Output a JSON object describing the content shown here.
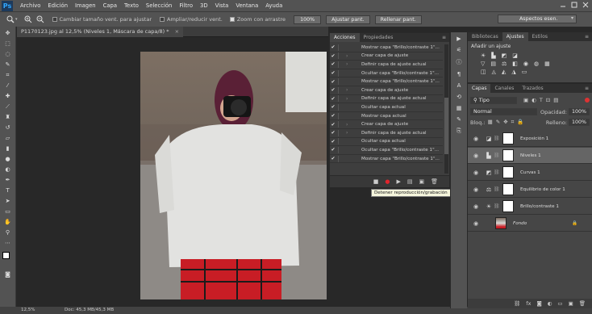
{
  "app": {
    "logo": "Ps"
  },
  "menu": [
    "Archivo",
    "Edición",
    "Imagen",
    "Capa",
    "Texto",
    "Selección",
    "Filtro",
    "3D",
    "Vista",
    "Ventana",
    "Ayuda"
  ],
  "options": {
    "resize_label": "Cambiar tamaño vent. para ajustar",
    "zoom_all_label": "Ampliar/reducir vent.",
    "scrubby_label": "Zoom con arrastre",
    "zoom_value": "100%",
    "fit_label": "Ajustar pant.",
    "fill_label": "Rellenar pant.",
    "workspace": "Aspectos esen."
  },
  "document": {
    "tab_title": "P1170123.jpg al 12,5% (Niveles 1, Máscara de capa/8) *",
    "zoom": "12,5%",
    "doc_size": "Doc: 45,3 MB/45,3 MB"
  },
  "actions_panel": {
    "tabs": [
      "Acciones",
      "Propiedades"
    ],
    "items": [
      {
        "label": "Mostrar capa \"Brillo/contraste 1\"...",
        "expand": false
      },
      {
        "label": "Crear capa de ajuste",
        "expand": true
      },
      {
        "label": "Definir capa de ajuste actual",
        "expand": true
      },
      {
        "label": "Ocultar capa \"Brillo/contraste 1\"...",
        "expand": false
      },
      {
        "label": "Mostrar capa \"Brillo/contraste 1\"...",
        "expand": false
      },
      {
        "label": "Crear capa de ajuste",
        "expand": true
      },
      {
        "label": "Definir capa de ajuste actual",
        "expand": true
      },
      {
        "label": "Ocultar capa actual",
        "expand": false
      },
      {
        "label": "Mostrar capa actual",
        "expand": false
      },
      {
        "label": "Crear capa de ajuste",
        "expand": true
      },
      {
        "label": "Definir capa de ajuste actual",
        "expand": true
      },
      {
        "label": "Ocultar capa actual",
        "expand": false
      },
      {
        "label": "Ocultar capa \"Brillo/contraste 1\"...",
        "expand": false
      },
      {
        "label": "Mostrar capa \"Brillo/contraste 1\"...",
        "expand": false
      }
    ],
    "tooltip": "Detener reproducción/grabación"
  },
  "adjustments_panel": {
    "tabs": [
      "Bibliotecas",
      "Ajustes",
      "Estilos"
    ],
    "heading": "Añadir un ajuste"
  },
  "layers_panel": {
    "tabs": [
      "Capas",
      "Canales",
      "Trazados"
    ],
    "filter": "Tipo",
    "blend_mode": "Normal",
    "opacity_label": "Opacidad:",
    "opacity_value": "100%",
    "lock_label": "Bloq.:",
    "fill_label": "Relleno:",
    "fill_value": "100%",
    "layers": [
      {
        "name": "Exposición 1",
        "icon": "exposure-icon",
        "selected": false
      },
      {
        "name": "Niveles 1",
        "icon": "levels-icon",
        "selected": true
      },
      {
        "name": "Curvas 1",
        "icon": "curves-icon",
        "selected": false
      },
      {
        "name": "Equilibrio de color 1",
        "icon": "color-balance-icon",
        "selected": false
      },
      {
        "name": "Brillo/contraste 1",
        "icon": "brightness-contrast-icon",
        "selected": false
      },
      {
        "name": "Fondo",
        "icon": "photo-thumbnail",
        "selected": false
      }
    ]
  }
}
